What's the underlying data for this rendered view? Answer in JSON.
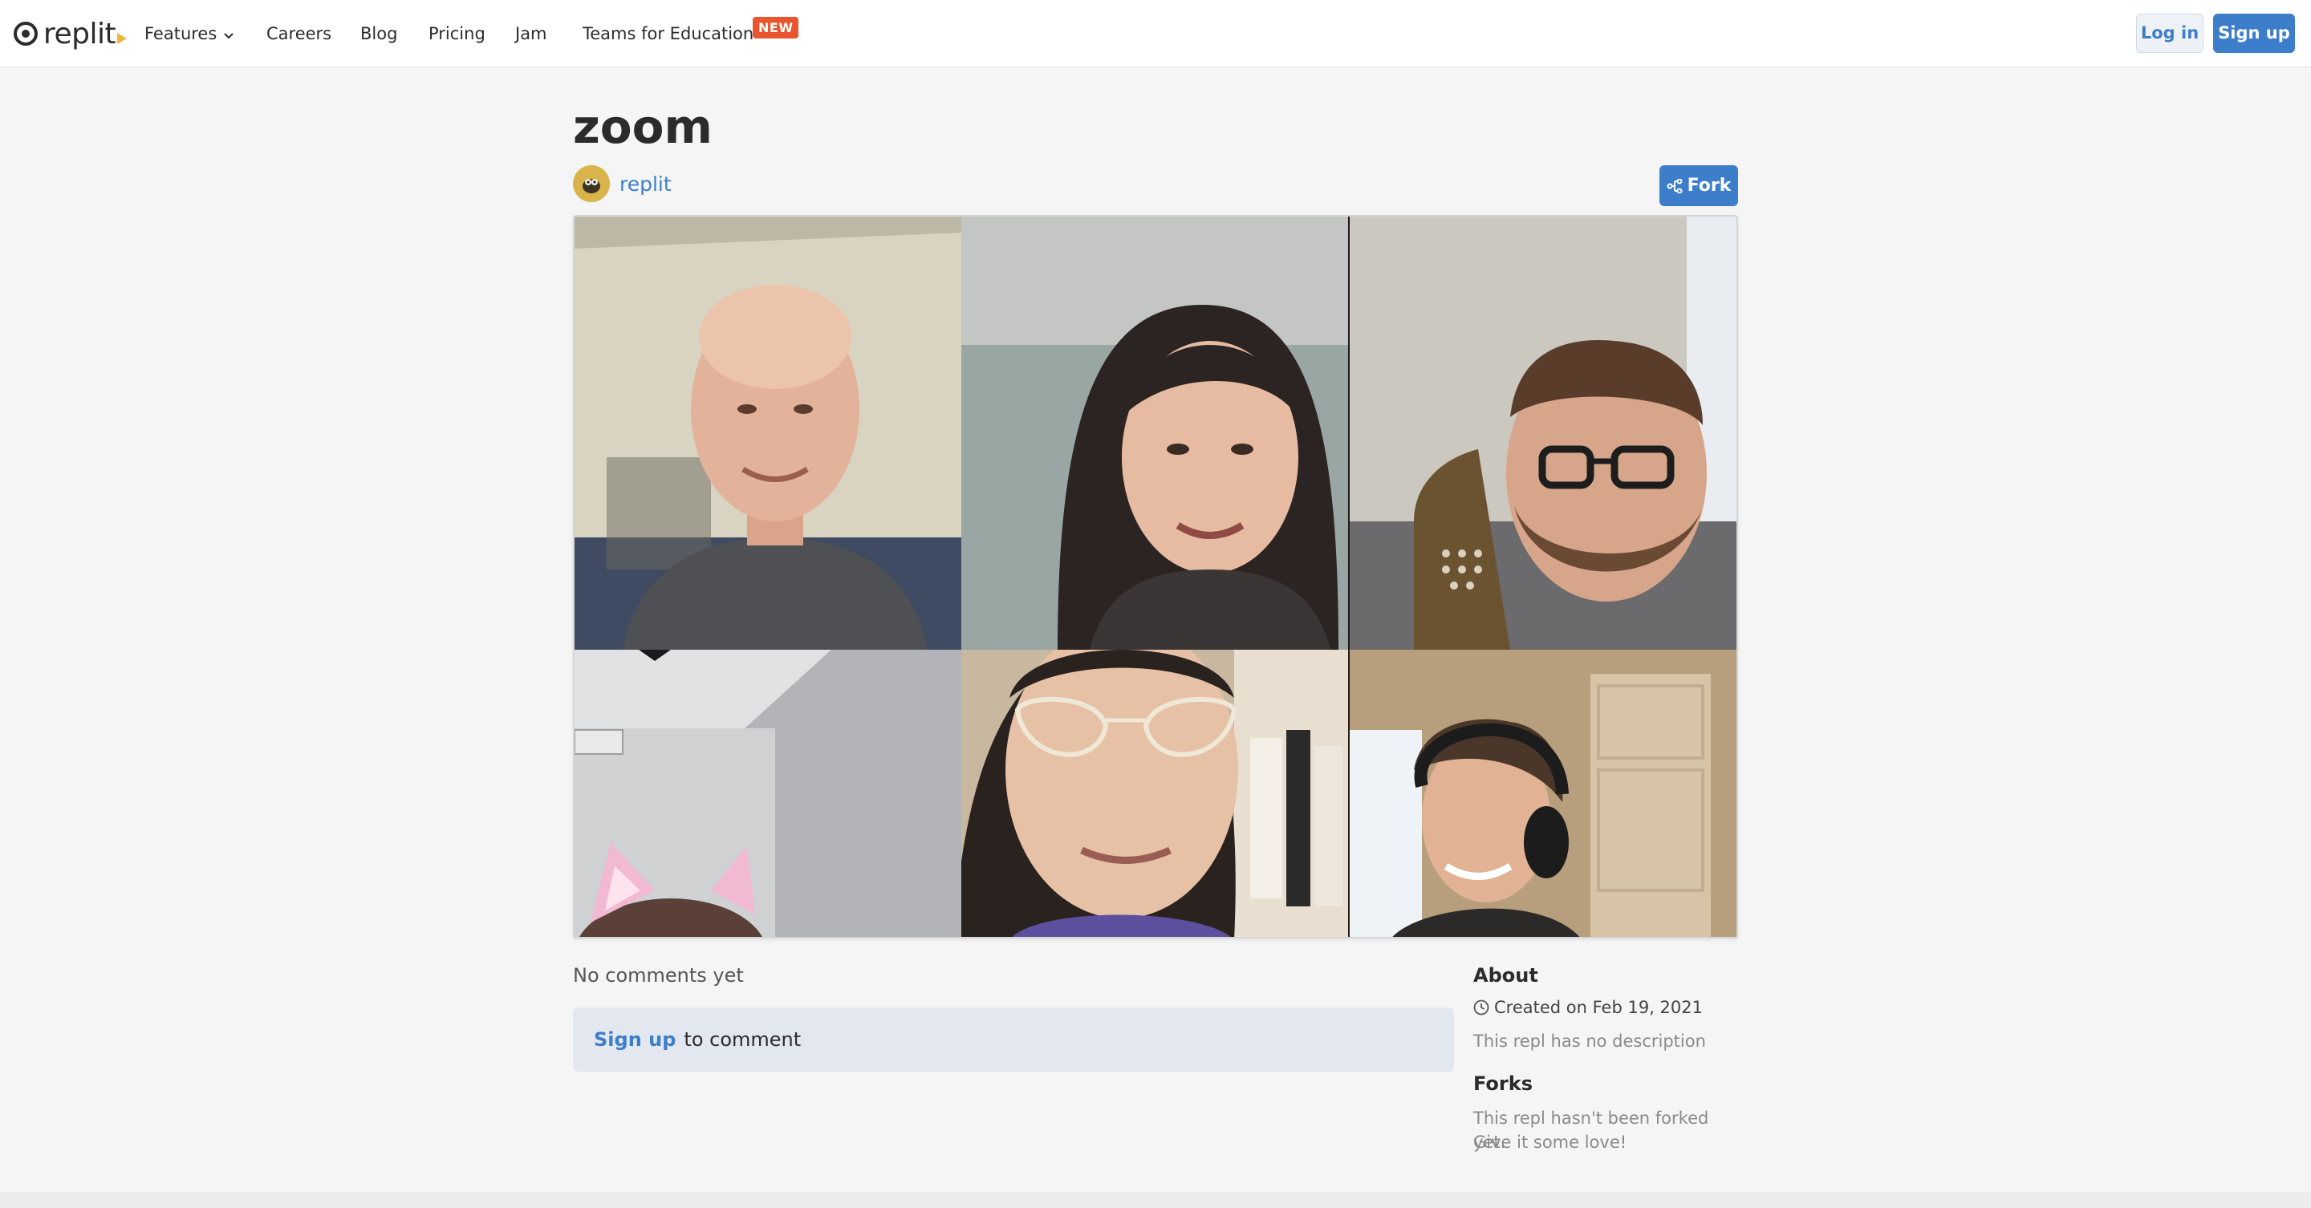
{
  "nav": {
    "logo_text": "replit",
    "items": [
      {
        "label": "Features"
      },
      {
        "label": "Careers"
      },
      {
        "label": "Blog"
      },
      {
        "label": "Pricing"
      },
      {
        "label": "Jam"
      },
      {
        "label": "Teams for Education"
      }
    ],
    "new_badge": "NEW",
    "login_label": "Log in",
    "signup_label": "Sign up"
  },
  "repl": {
    "title": "zoom",
    "owner": "replit",
    "fork_label": "Fork"
  },
  "video_tiles": [
    {
      "name": "participant-1",
      "bg": "#cfcbb8"
    },
    {
      "name": "participant-2",
      "bg": "#8f9c9a"
    },
    {
      "name": "participant-3",
      "bg": "#c9c7c0"
    },
    {
      "name": "participant-4",
      "bg": "#c7c8ca"
    },
    {
      "name": "participant-5",
      "bg": "#b9a38a"
    },
    {
      "name": "participant-6",
      "bg": "#b59a77"
    }
  ],
  "comments": {
    "empty_text": "No comments yet",
    "signup_link": "Sign up",
    "signup_suffix": "to comment"
  },
  "sidebar": {
    "about_heading": "About",
    "created": "Created on Feb 19, 2021",
    "description": "This repl has no description",
    "forks_heading": "Forks",
    "forks_text_1": "This repl hasn't been forked yet.",
    "forks_text_2": "Give it some love!"
  },
  "colors": {
    "accent": "#3d7ecb",
    "badge": "#e8552f",
    "background": "#f5f5f5"
  }
}
